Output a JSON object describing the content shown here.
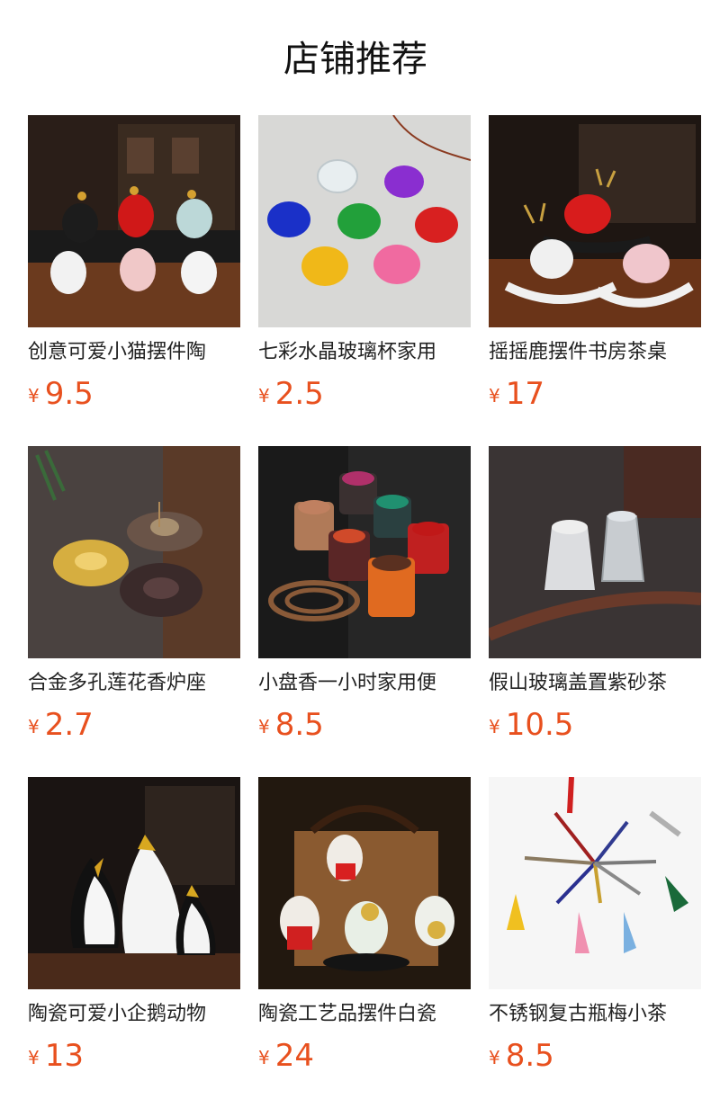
{
  "header": {
    "title": "店铺推荐"
  },
  "currency_symbol": "¥",
  "products": [
    {
      "name": "创意可爱小猫摆件陶",
      "price": "9.5",
      "image": "cat-figurines-image"
    },
    {
      "name": "七彩水晶玻璃杯家用",
      "price": "2.5",
      "image": "crystal-cups-image"
    },
    {
      "name": "摇摇鹿摆件书房茶桌",
      "price": "17",
      "image": "rocking-deer-image"
    },
    {
      "name": "合金多孔莲花香炉座",
      "price": "2.7",
      "image": "lotus-incense-burner-image"
    },
    {
      "name": "小盘香一小时家用便",
      "price": "8.5",
      "image": "coil-incense-image"
    },
    {
      "name": "假山玻璃盖置紫砂茶",
      "price": "10.5",
      "image": "glass-lid-holder-image"
    },
    {
      "name": "陶瓷可爱小企鹅动物",
      "price": "13",
      "image": "penguin-figurines-image"
    },
    {
      "name": "陶瓷工艺品摆件白瓷",
      "price": "24",
      "image": "lucky-cat-figurines-image"
    },
    {
      "name": "不锈钢复古瓶梅小茶",
      "price": "8.5",
      "image": "vintage-scissors-image"
    }
  ]
}
